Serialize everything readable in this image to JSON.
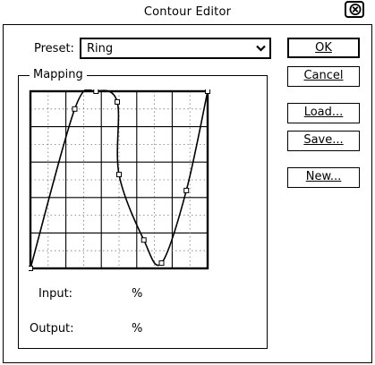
{
  "dialog": {
    "title": "Contour Editor",
    "close_icon": "close-x-icon"
  },
  "preset": {
    "label": "Preset:",
    "selected": "Ring"
  },
  "buttons": {
    "ok": "OK",
    "cancel": "Cancel",
    "load": "Load...",
    "save": "Save...",
    "new": "New..."
  },
  "mapping": {
    "legend": "Mapping",
    "grid_divisions": 10,
    "curve_points": [
      [
        0,
        0
      ],
      [
        25,
        90
      ],
      [
        37,
        100
      ],
      [
        49,
        94
      ],
      [
        50,
        53
      ],
      [
        64,
        16
      ],
      [
        74,
        3
      ],
      [
        88,
        44
      ],
      [
        100,
        100
      ]
    ]
  },
  "readouts": {
    "input_label": "Input:",
    "input_unit": "%",
    "output_label": "Output:",
    "output_unit": "%"
  }
}
